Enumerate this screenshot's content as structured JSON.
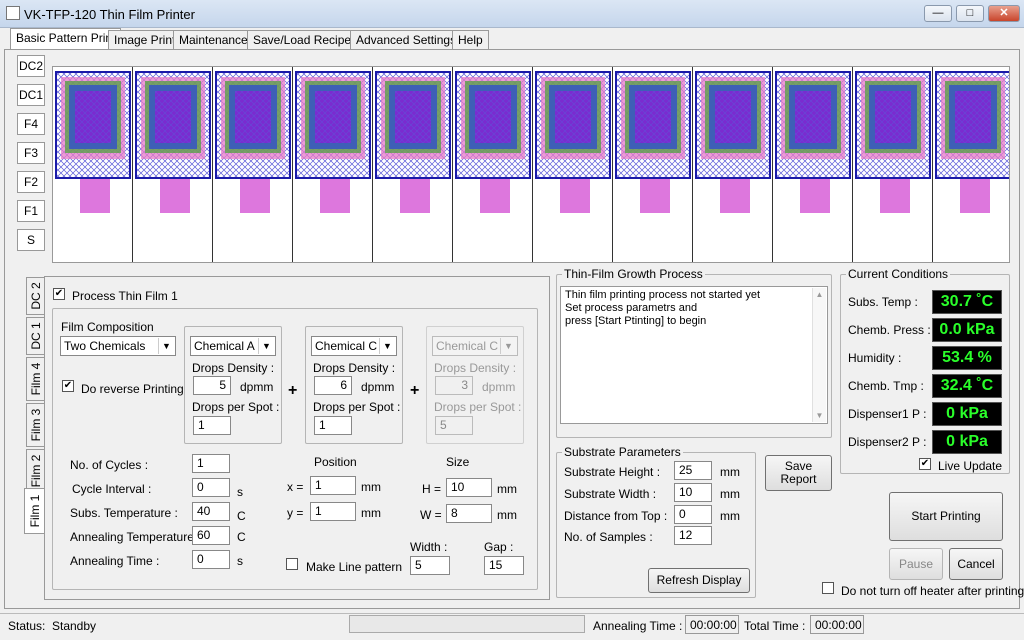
{
  "window": {
    "title": "VK-TFP-120 Thin Film Printer"
  },
  "tabs": [
    "Basic Pattern Print",
    "Image Print",
    "Maintenance",
    "Save/Load Recipe",
    "Advanced Settings",
    "Help"
  ],
  "side_buttons": [
    "DC2",
    "DC1",
    "F4",
    "F3",
    "F2",
    "F1",
    "S"
  ],
  "pattern_columns": 12,
  "film_tabs": [
    "DC 2",
    "DC 1",
    "Film 4",
    "Film 3",
    "Film 2",
    "Film 1"
  ],
  "film": {
    "process_label": "Process Thin Film 1",
    "composition_label": "Film Composition",
    "composition_value": "Two Chemicals",
    "reverse_label": "Do reverse Printing",
    "chemicals": [
      {
        "name": "Chemical A",
        "density_label": "Drops Density :",
        "density": "5",
        "unit": "dpmm",
        "spot_label": "Drops per Spot :",
        "spot": "1"
      },
      {
        "name": "Chemical C",
        "density_label": "Drops Density :",
        "density": "6",
        "unit": "dpmm",
        "spot_label": "Drops per Spot :",
        "spot": "1"
      },
      {
        "name": "Chemical C",
        "density_label": "Drops Density :",
        "density": "3",
        "unit": "dpmm",
        "spot_label": "Drops per Spot :",
        "spot": "5"
      }
    ],
    "plus": "+",
    "params": [
      {
        "label": "No. of Cycles :",
        "value": "1",
        "unit": ""
      },
      {
        "label": "Cycle Interval :",
        "value": "0",
        "unit": "s"
      },
      {
        "label": "Subs. Temperature :",
        "value": "40",
        "unit": "C"
      },
      {
        "label": "Annealing Temperature :",
        "value": "60",
        "unit": "C"
      },
      {
        "label": "Annealing Time :",
        "value": "0",
        "unit": "s"
      }
    ],
    "position": {
      "title": "Position",
      "x_label": "x =",
      "x": "1",
      "y_label": "y =",
      "y": "1",
      "unit": "mm"
    },
    "size": {
      "title": "Size",
      "h_label": "H =",
      "h": "10",
      "w_label": "W =",
      "w": "8",
      "unit": "mm"
    },
    "line_label": "Make Line pattern",
    "width_label": "Width :",
    "width": "5",
    "gap_label": "Gap :",
    "gap": "15"
  },
  "growth": {
    "title": "Thin-Film Growth Process",
    "lines": [
      "Thin film printing process not started yet",
      "Set process parametrs and",
      "press [Start Ptinting] to begin"
    ]
  },
  "substrate": {
    "title": "Substrate Parameters",
    "rows": [
      {
        "label": "Substrate Height :",
        "value": "25",
        "unit": "mm"
      },
      {
        "label": "Substrate Width :",
        "value": "10",
        "unit": "mm"
      },
      {
        "label": "Distance from Top :",
        "value": "0",
        "unit": "mm"
      },
      {
        "label": "No. of Samples :",
        "value": "12",
        "unit": ""
      }
    ],
    "refresh_label": "Refresh Display"
  },
  "save_report": [
    "Save",
    "Report"
  ],
  "conditions": {
    "title": "Current Conditions",
    "rows": [
      {
        "label": "Subs. Temp :",
        "value": "30.7 ˚C"
      },
      {
        "label": "Chemb. Press :",
        "value": "0.0 kPa"
      },
      {
        "label": "Humidity :",
        "value": "53.4 %"
      },
      {
        "label": "Chemb. Tmp :",
        "value": "32.4 ˚C"
      },
      {
        "label": "Dispenser1 P :",
        "value": "0 kPa"
      },
      {
        "label": "Dispenser2 P :",
        "value": "0 kPa"
      }
    ],
    "live_label": "Live Update"
  },
  "actions": {
    "start": "Start Printing",
    "pause": "Pause",
    "cancel": "Cancel",
    "heater_label": "Do not turn off heater after printing"
  },
  "status": {
    "label": "Status:",
    "value": "Standby",
    "annealing_label": "Annealing Time :",
    "annealing": "00:00:00",
    "total_label": "Total Time :",
    "total": "00:00:00"
  },
  "colors": {
    "lcd_text": "#2aff2a",
    "pattern_purple": "#7a2bd0",
    "pattern_pink": "#dd77dd",
    "pattern_blue": "#1a1aa8"
  }
}
